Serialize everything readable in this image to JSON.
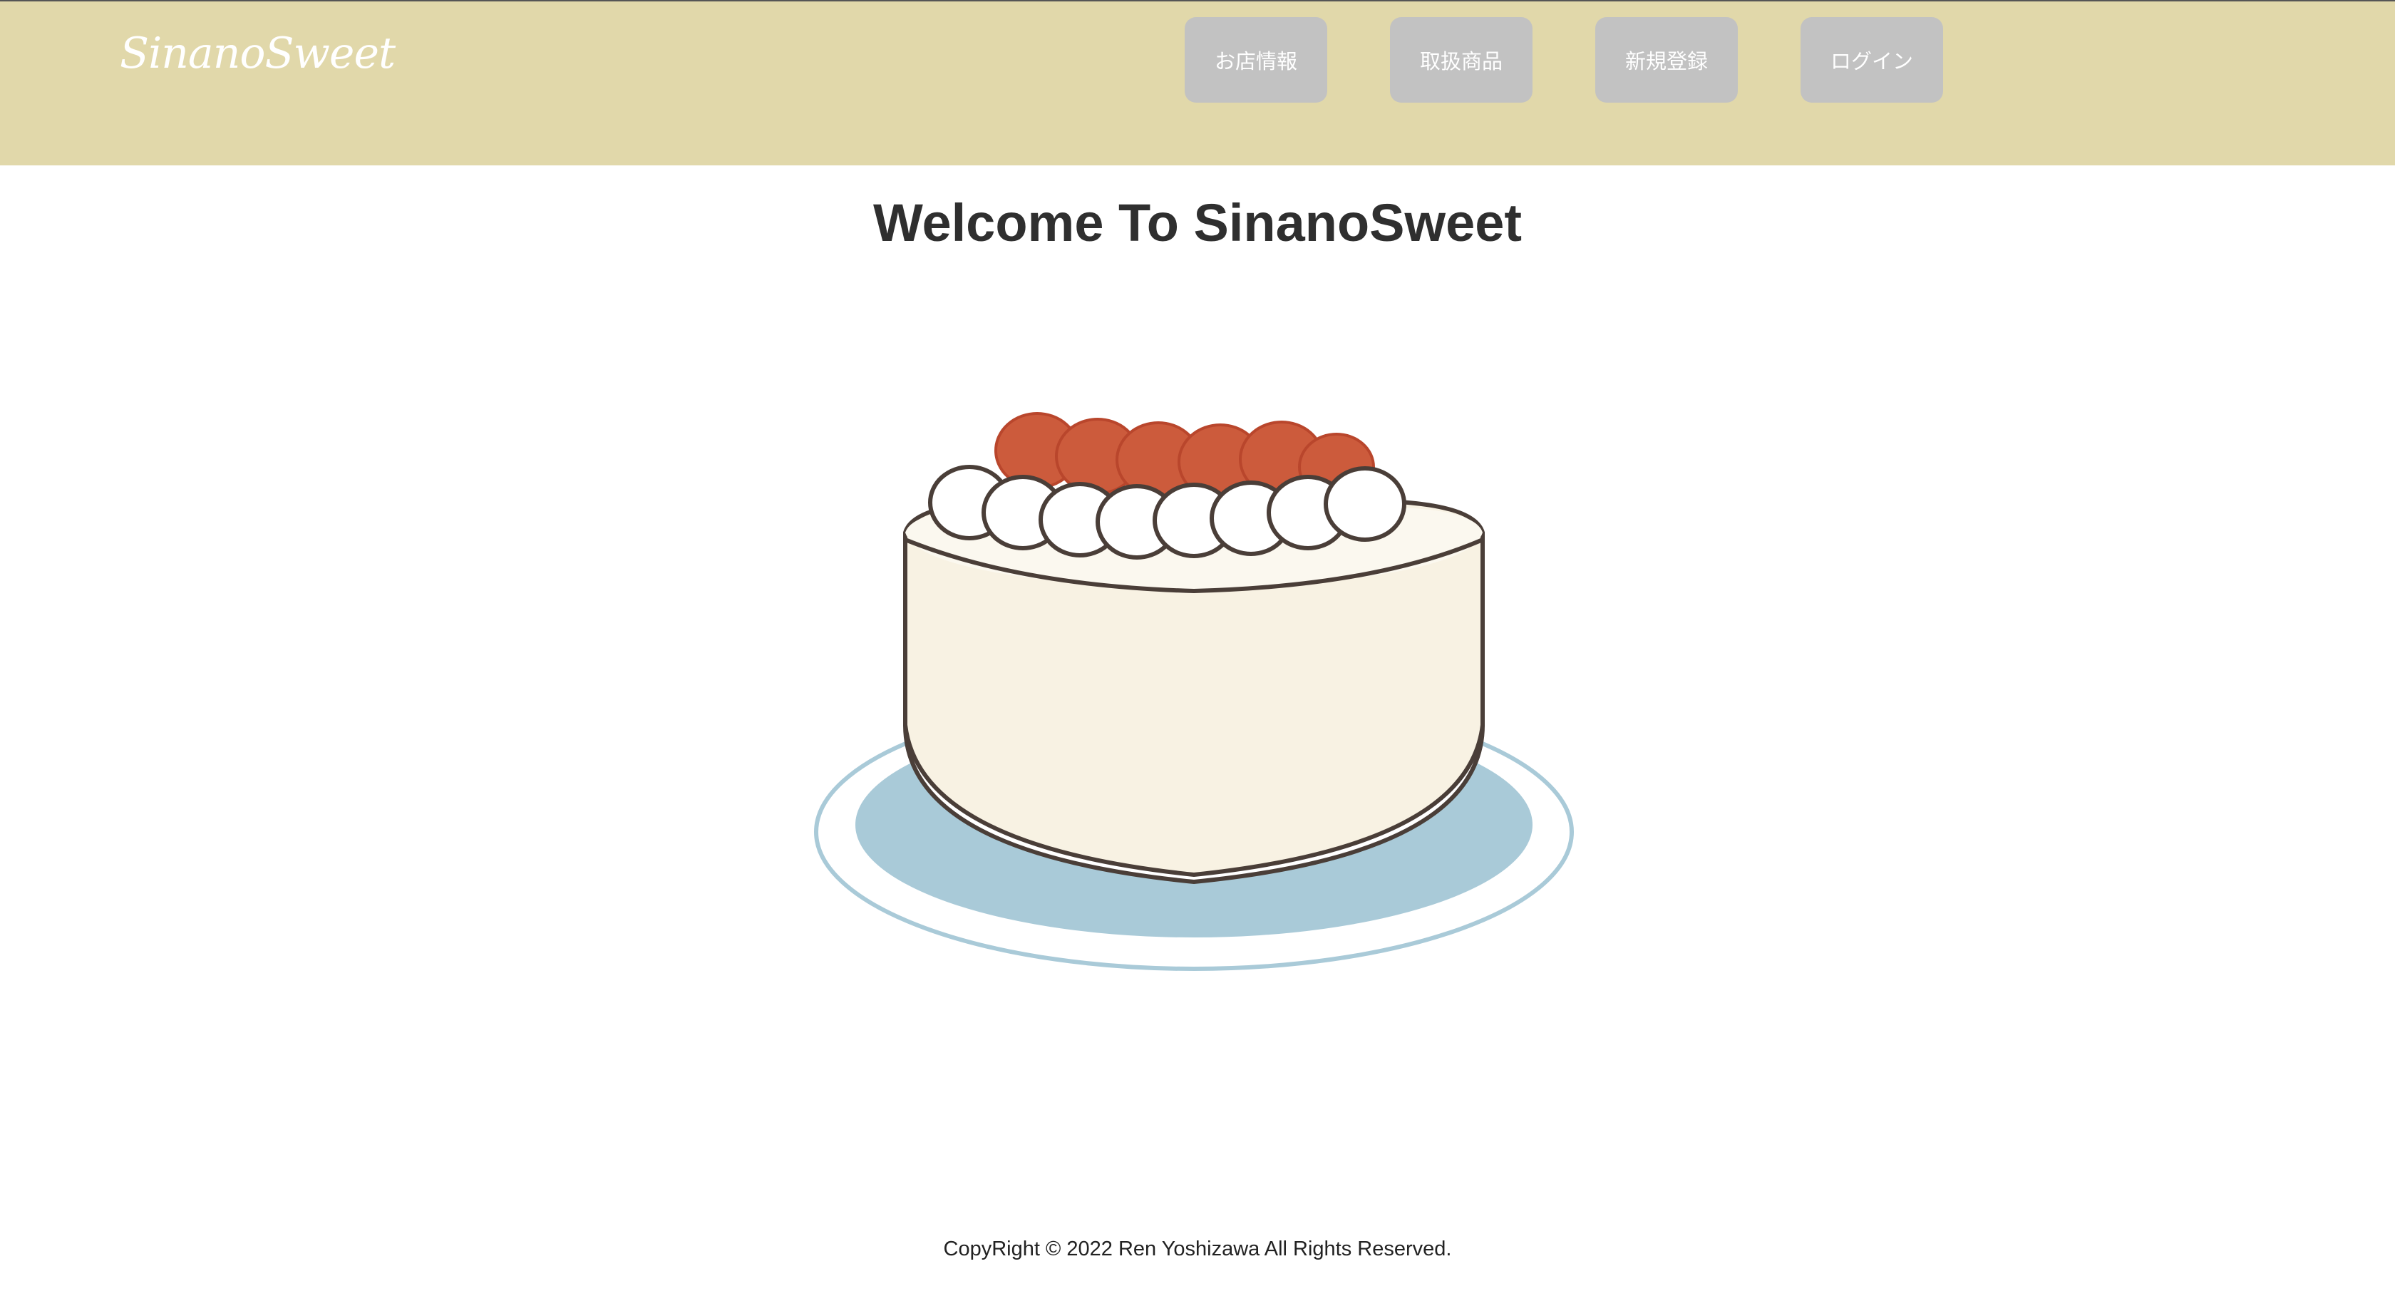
{
  "brand": {
    "logo": "SinanoSweet"
  },
  "nav": [
    {
      "label": "お店情報"
    },
    {
      "label": "取扱商品"
    },
    {
      "label": "新規登録"
    },
    {
      "label": "ログイン"
    }
  ],
  "main": {
    "title": "Welcome To SinanoSweet",
    "hero_image": "cake-illustration"
  },
  "footer": {
    "copyright": "CopyRight © 2022 Ren Yoshizawa All Rights Reserved."
  },
  "colors": {
    "header_bg": "#e1d8aa",
    "nav_button_bg": "#c2c2c2",
    "plate": "#a9cad8",
    "strawberry": "#cc5b3c",
    "cream": "#f8f2e3"
  }
}
